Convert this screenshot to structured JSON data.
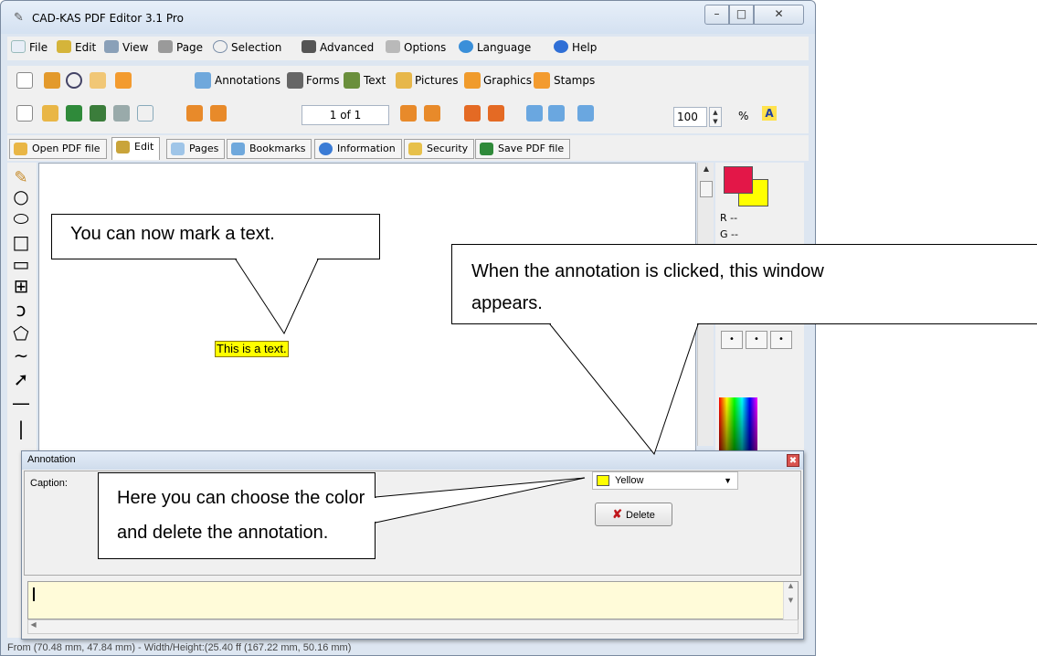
{
  "window": {
    "title": "CAD-KAS PDF Editor 3.1 Pro"
  },
  "menu": [
    "File",
    "Edit",
    "View",
    "Page",
    "Selection",
    "Advanced",
    "Options",
    "Language",
    "Help"
  ],
  "toolbar1": {
    "annotations": "Annotations",
    "forms": "Forms",
    "text": "Text",
    "pictures": "Pictures",
    "graphics": "Graphics",
    "stamps": "Stamps"
  },
  "toolbar2": {
    "page": "1 of 1",
    "zoom": "100",
    "zoom_unit": "%"
  },
  "tabs": [
    "Open PDF file",
    "Edit",
    "Pages",
    "Bookmarks",
    "Information",
    "Security",
    "Save PDF file"
  ],
  "right_panel": {
    "r": "R --",
    "g": "G --",
    "dots": [
      "•",
      "•",
      "•"
    ]
  },
  "document": {
    "highlighted_text": "This is a text."
  },
  "dialog": {
    "title": "Annotation",
    "caption_label": "Caption:",
    "color": "Yellow",
    "delete": "Delete",
    "close": "✖"
  },
  "status": "From (70.48 mm, 47.84 mm) - Width/Height:(25.40 ff (167.22 mm, 50.16 mm)",
  "callouts": {
    "c1": "You can now mark a text.",
    "c2_l1": "When the annotation is clicked, this window",
    "c2_l2": "appears.",
    "c3_l1": "Here you can choose the color",
    "c3_l2": "and delete the annotation."
  },
  "colors": {
    "fg": "#e31748",
    "bg": "#ffff00",
    "highlight": "#ffff00",
    "note": "#fffbd9"
  },
  "icons": {
    "window": [
      "minimize-icon",
      "maximize-icon",
      "close-icon"
    ]
  }
}
